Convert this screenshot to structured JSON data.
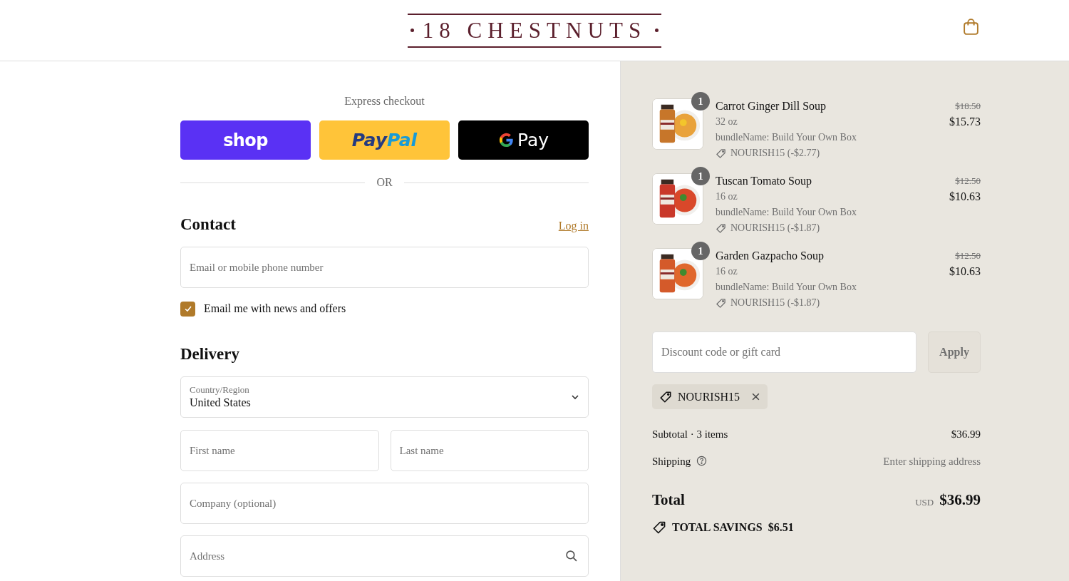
{
  "header": {
    "logo": "18 CHESTNUTS"
  },
  "express": {
    "title": "Express checkout",
    "buttons": [
      {
        "kind": "shop",
        "label": "shop"
      },
      {
        "kind": "paypal",
        "label_parts": [
          "Pay",
          "Pal"
        ]
      },
      {
        "kind": "gpay",
        "label": "Pay"
      }
    ],
    "divider": "OR"
  },
  "contact": {
    "title": "Contact",
    "login": "Log in",
    "email": {
      "placeholder": "Email or mobile phone number"
    },
    "newsletter": {
      "label": "Email me with news and offers",
      "checked": true
    }
  },
  "delivery": {
    "title": "Delivery",
    "country": {
      "label": "Country/Region",
      "value": "United States"
    },
    "first_name": {
      "placeholder": "First name"
    },
    "last_name": {
      "placeholder": "Last name"
    },
    "company": {
      "placeholder": "Company (optional)"
    },
    "address": {
      "placeholder": "Address"
    }
  },
  "cart": {
    "items": [
      {
        "quantity": "1",
        "name": "Carrot Ginger Dill Soup",
        "size": "32 oz",
        "bundle": "bundleName: Build Your Own Box",
        "discount": "NOURISH15 (-$2.77)",
        "original_price": "$18.50",
        "price": "$15.73"
      },
      {
        "quantity": "1",
        "name": "Tuscan Tomato Soup",
        "size": "16 oz",
        "bundle": "bundleName: Build Your Own Box",
        "discount": "NOURISH15 (-$1.87)",
        "original_price": "$12.50",
        "price": "$10.63"
      },
      {
        "quantity": "1",
        "name": "Garden Gazpacho Soup",
        "size": "16 oz",
        "bundle": "bundleName: Build Your Own Box",
        "discount": "NOURISH15 (-$1.87)",
        "original_price": "$12.50",
        "price": "$10.63"
      }
    ],
    "discount_field": {
      "placeholder": "Discount code or gift card"
    },
    "apply": "Apply",
    "applied_code": "NOURISH15",
    "subtotal": {
      "label": "Subtotal · 3 items",
      "value": "$36.99"
    },
    "shipping": {
      "label": "Shipping",
      "value": "Enter shipping address"
    },
    "total": {
      "label": "Total",
      "currency": "USD",
      "value": "$36.99"
    },
    "savings": {
      "label": "TOTAL SAVINGS",
      "value": "$6.51"
    }
  }
}
